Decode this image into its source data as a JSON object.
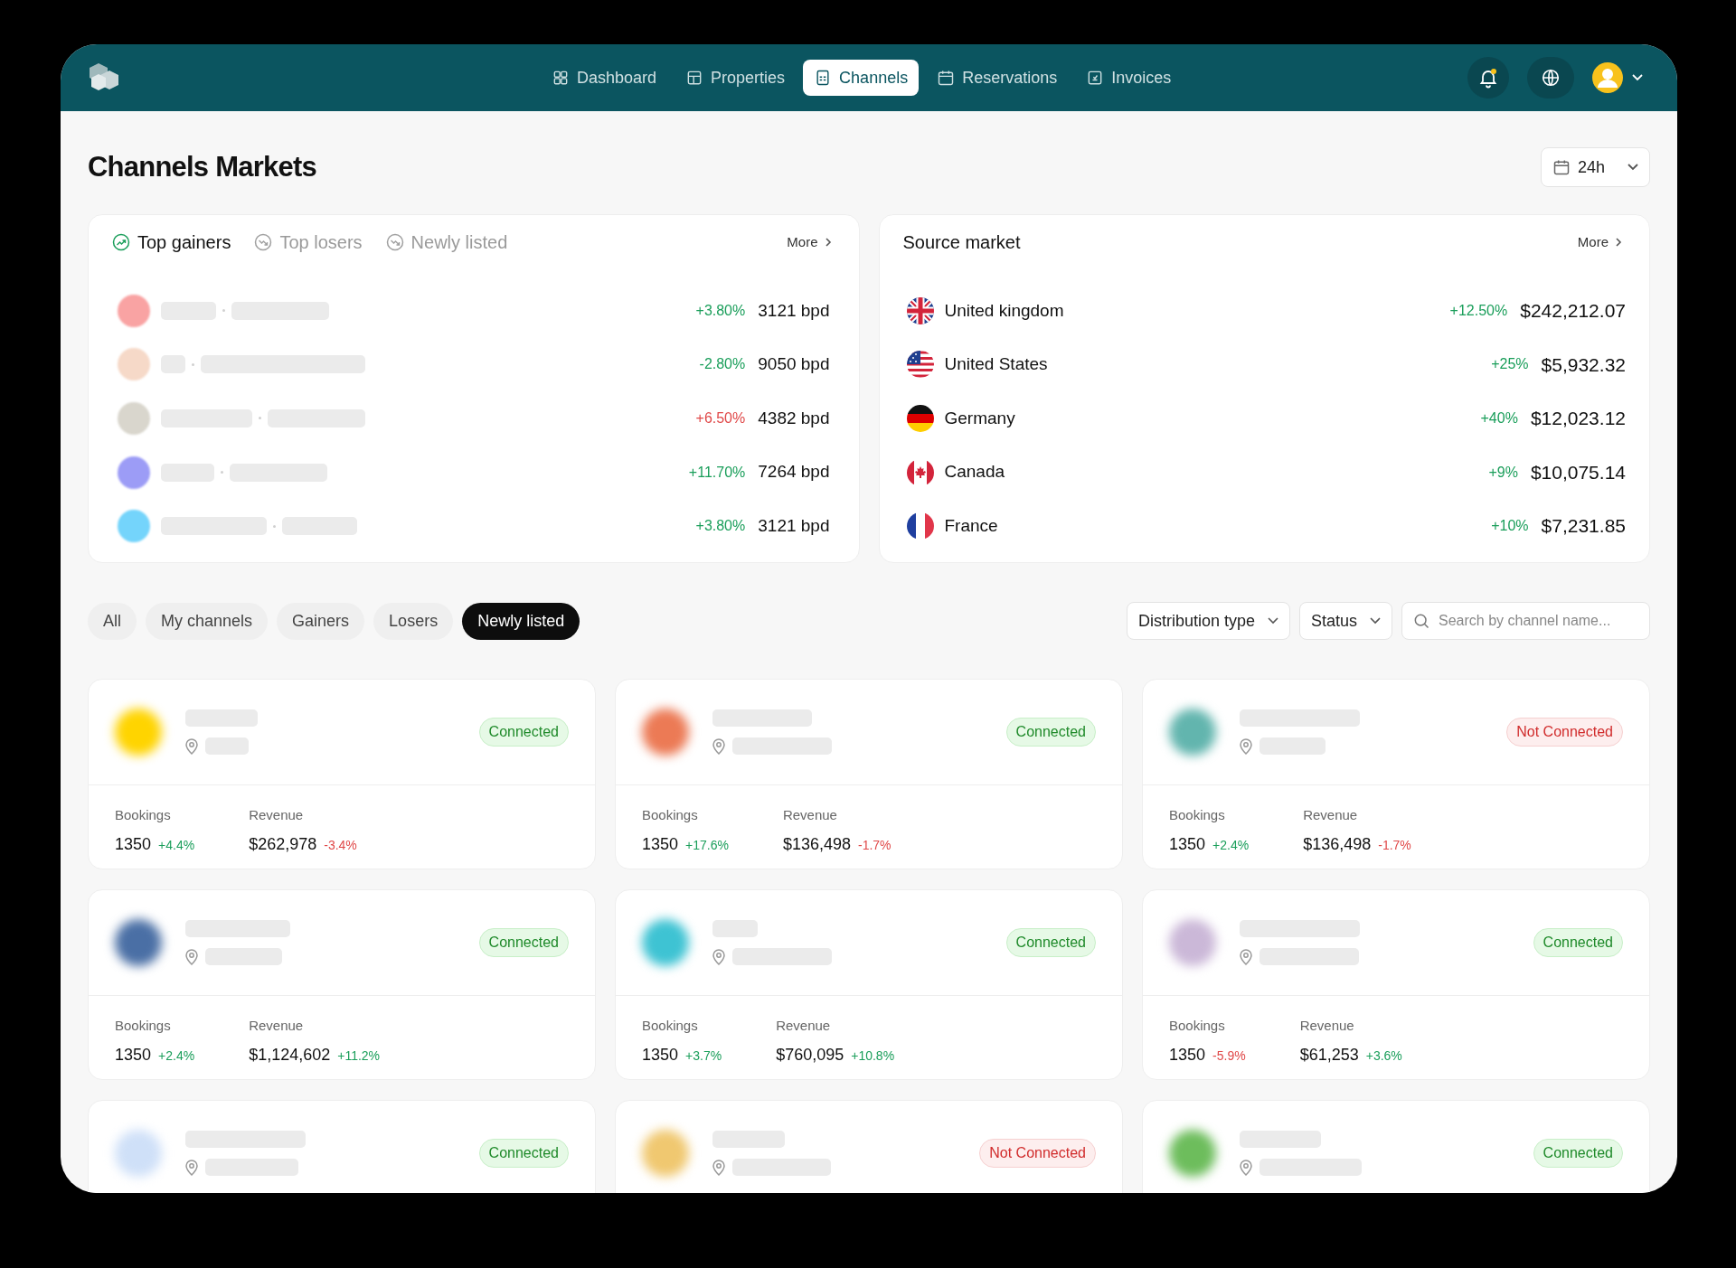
{
  "nav": [
    {
      "label": "Dashboard",
      "selected": false
    },
    {
      "label": "Properties",
      "selected": false
    },
    {
      "label": "Channels",
      "selected": true
    },
    {
      "label": "Reservations",
      "selected": false
    },
    {
      "label": "Invoices",
      "selected": false
    }
  ],
  "notifications": {
    "unread": true
  },
  "page_title": "Channels Markets",
  "period": {
    "value": "24h"
  },
  "movers": {
    "tabs": [
      {
        "label": "Top gainers",
        "selected": true
      },
      {
        "label": "Top losers",
        "selected": false
      },
      {
        "label": "Newly listed",
        "selected": false
      }
    ],
    "more": "More",
    "rows": [
      {
        "color": "#f9a3a3",
        "change": "+3.80%",
        "kind": "gain",
        "volume": "3121 bpd"
      },
      {
        "color": "#f6d9c8",
        "change": "-2.80%",
        "kind": "gain",
        "volume": "9050 bpd"
      },
      {
        "color": "#d9d6cd",
        "change": "+6.50%",
        "kind": "loss",
        "volume": "4382 bpd"
      },
      {
        "color": "#9c9cf6",
        "change": "+11.70%",
        "kind": "gain",
        "volume": "7264 bpd"
      },
      {
        "color": "#74d4fb",
        "change": "+3.80%",
        "kind": "gain",
        "volume": "3121 bpd"
      }
    ]
  },
  "source_market": {
    "title": "Source market",
    "more": "More",
    "rows": [
      {
        "kind": "gb",
        "country": "United kingdom",
        "change": "+12.50%",
        "amount": "$242,212.07"
      },
      {
        "kind": "us",
        "country": "United States",
        "change": "+25%",
        "amount": "$5,932.32"
      },
      {
        "kind": "de",
        "country": "Germany",
        "change": "+40%",
        "amount": "$12,023.12"
      },
      {
        "kind": "ca",
        "country": "Canada",
        "change": "+9%",
        "amount": "$10,075.14"
      },
      {
        "kind": "fr",
        "country": "France",
        "change": "+10%",
        "amount": "$7,231.85"
      }
    ]
  },
  "filters": {
    "chips": [
      {
        "label": "All",
        "selected": false
      },
      {
        "label": "My channels",
        "selected": false
      },
      {
        "label": "Gainers",
        "selected": false
      },
      {
        "label": "Losers",
        "selected": false
      },
      {
        "label": "Newly listed",
        "selected": true
      }
    ],
    "dropdowns": [
      "Distribution type",
      "Status"
    ],
    "search": {
      "placeholder": "Search by channel name..."
    }
  },
  "channels": [
    {
      "color": "#ffd400",
      "kind": "connected",
      "status_label": "Connected",
      "stats": [
        {
          "label": "Bookings",
          "value": "1350",
          "change": "+4.4%",
          "kind": "gain"
        },
        {
          "label": "Revenue",
          "value": "$262,978",
          "change": "-3.4%",
          "kind": "loss"
        }
      ]
    },
    {
      "color": "#ec7a55",
      "kind": "connected",
      "status_label": "Connected",
      "stats": [
        {
          "label": "Bookings",
          "value": "1350",
          "change": "+17.6%",
          "kind": "gain"
        },
        {
          "label": "Revenue",
          "value": "$136,498",
          "change": "-1.7%",
          "kind": "loss"
        }
      ]
    },
    {
      "color": "#62b5ae",
      "kind": "not_connected",
      "status_label": "Not Connected",
      "stats": [
        {
          "label": "Bookings",
          "value": "1350",
          "change": "+2.4%",
          "kind": "gain"
        },
        {
          "label": "Revenue",
          "value": "$136,498",
          "change": "-1.7%",
          "kind": "loss"
        }
      ]
    },
    {
      "color": "#4a6fa5",
      "kind": "connected",
      "status_label": "Connected",
      "stats": [
        {
          "label": "Bookings",
          "value": "1350",
          "change": "+2.4%",
          "kind": "gain"
        },
        {
          "label": "Revenue",
          "value": "$1,124,602",
          "change": "+11.2%",
          "kind": "gain"
        }
      ]
    },
    {
      "color": "#3ec3d3",
      "kind": "connected",
      "status_label": "Connected",
      "stats": [
        {
          "label": "Bookings",
          "value": "1350",
          "change": "+3.7%",
          "kind": "gain"
        },
        {
          "label": "Revenue",
          "value": "$760,095",
          "change": "+10.8%",
          "kind": "gain"
        }
      ]
    },
    {
      "color": "#cbb8d8",
      "kind": "connected",
      "status_label": "Connected",
      "stats": [
        {
          "label": "Bookings",
          "value": "1350",
          "change": "-5.9%",
          "kind": "loss"
        },
        {
          "label": "Revenue",
          "value": "$61,253",
          "change": "+3.6%",
          "kind": "gain"
        }
      ]
    },
    {
      "color": "#cfe0f8",
      "kind": "connected",
      "status_label": "Connected"
    },
    {
      "color": "#f0c870",
      "kind": "not_connected",
      "status_label": "Not Connected"
    },
    {
      "color": "#6dbd5c",
      "kind": "connected",
      "status_label": "Connected"
    }
  ]
}
